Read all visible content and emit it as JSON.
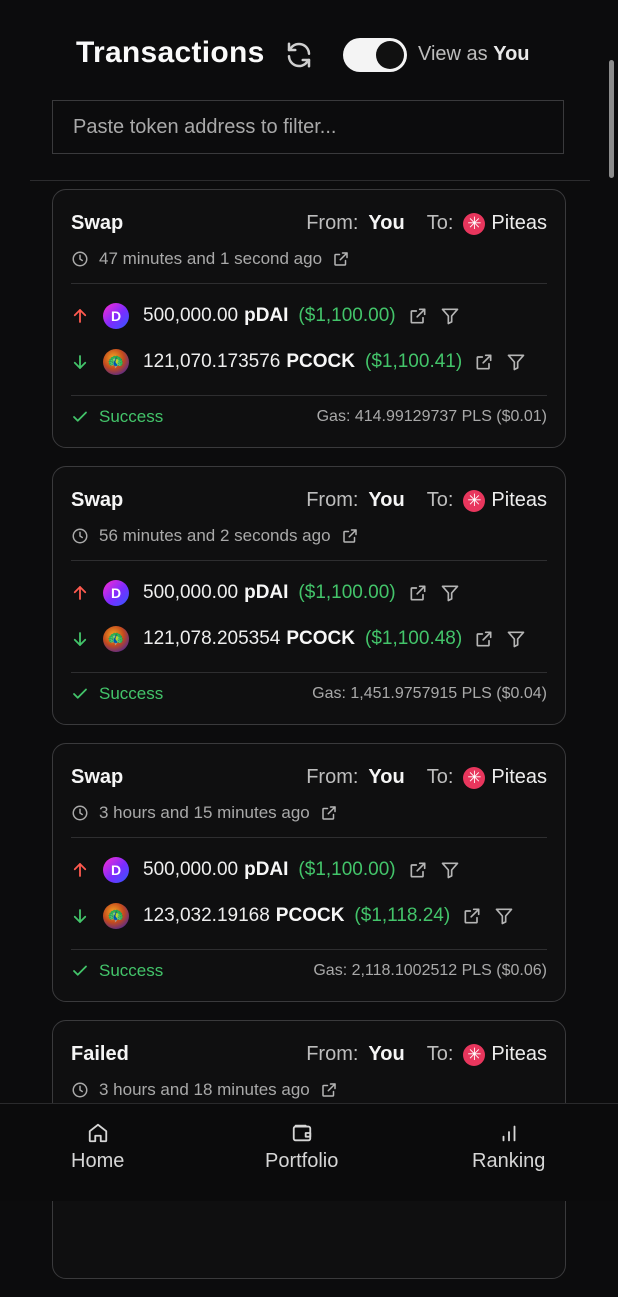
{
  "header": {
    "title": "Transactions",
    "view_as_prefix": "View as",
    "view_as_value": "You",
    "toggle_on": true
  },
  "filter": {
    "placeholder": "Paste token address to filter..."
  },
  "transactions": [
    {
      "type": "Swap",
      "from_label": "From:",
      "from": "You",
      "to_label": "To:",
      "to": "Piteas",
      "time": "47 minutes and 1 second ago",
      "out": {
        "amount": "500,000.00",
        "symbol": "pDAI",
        "usd": "($1,100.00)"
      },
      "in": {
        "amount": "121,070.173576",
        "symbol": "PCOCK",
        "usd": "($1,100.41)"
      },
      "status": "Success",
      "gas": "Gas: 414.99129737 PLS ($0.01)"
    },
    {
      "type": "Swap",
      "from_label": "From:",
      "from": "You",
      "to_label": "To:",
      "to": "Piteas",
      "time": "56 minutes and 2 seconds ago",
      "out": {
        "amount": "500,000.00",
        "symbol": "pDAI",
        "usd": "($1,100.00)"
      },
      "in": {
        "amount": "121,078.205354",
        "symbol": "PCOCK",
        "usd": "($1,100.48)"
      },
      "status": "Success",
      "gas": "Gas: 1,451.9757915 PLS ($0.04)"
    },
    {
      "type": "Swap",
      "from_label": "From:",
      "from": "You",
      "to_label": "To:",
      "to": "Piteas",
      "time": "3 hours and 15 minutes ago",
      "out": {
        "amount": "500,000.00",
        "symbol": "pDAI",
        "usd": "($1,100.00)"
      },
      "in": {
        "amount": "123,032.19168",
        "symbol": "PCOCK",
        "usd": "($1,118.24)"
      },
      "status": "Success",
      "gas": "Gas: 2,118.1002512 PLS ($0.06)"
    },
    {
      "type": "Failed",
      "from_label": "From:",
      "from": "You",
      "to_label": "To:",
      "to": "Piteas",
      "time": "3 hours and 18 minutes ago"
    }
  ],
  "nav": [
    {
      "label": "Home",
      "icon": "home-icon"
    },
    {
      "label": "Portfolio",
      "icon": "wallet-icon"
    },
    {
      "label": "Ranking",
      "icon": "bar-chart-icon"
    }
  ],
  "colors": {
    "background": "#0c0c0d",
    "success": "#43c46a",
    "up_arrow": "#ff5a4f",
    "down_arrow": "#43c46a",
    "piteas": "#e8365d"
  }
}
